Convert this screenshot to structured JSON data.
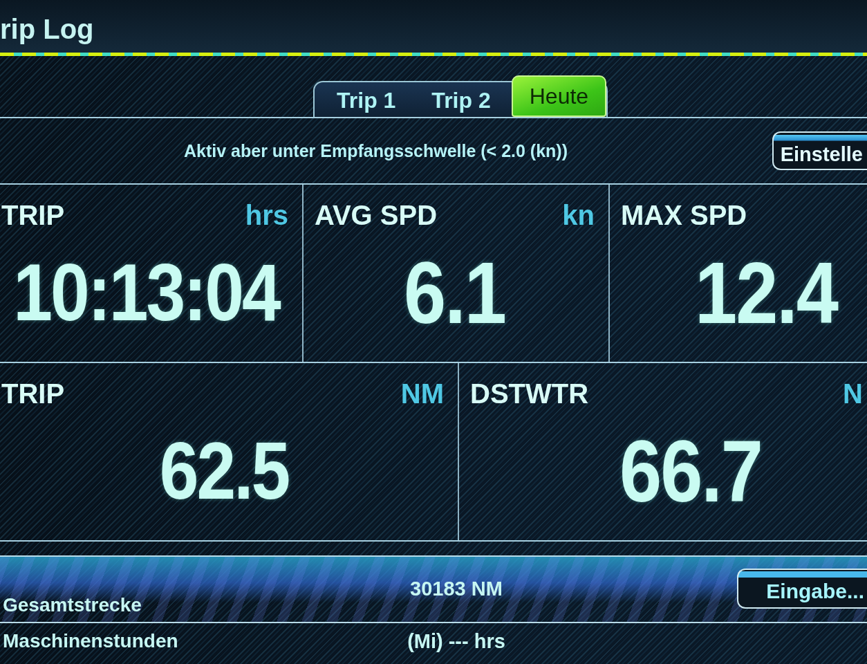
{
  "screen": {
    "title": "rip Log"
  },
  "tabs": [
    {
      "label": "Trip 1",
      "selected": false
    },
    {
      "label": "Trip 2",
      "selected": false
    },
    {
      "label": "Heute",
      "selected": true
    }
  ],
  "status_message": "Aktiv aber unter Empfangsschwelle (< 2.0 (kn))",
  "settings_button": "Einstelle",
  "tile_rows": [
    {
      "tiles": [
        {
          "label": "TRIP",
          "unit": "hrs",
          "value": "10:13:04"
        },
        {
          "label": "AVG SPD",
          "unit": "kn",
          "value": "6.1"
        },
        {
          "label": "MAX SPD",
          "value": "12.4"
        }
      ]
    },
    {
      "tiles": [
        {
          "label": "TRIP",
          "unit": "NM",
          "value": "62.5"
        },
        {
          "label": "DSTWTR",
          "unit": "N",
          "value": "66.7"
        }
      ]
    }
  ],
  "totals": [
    {
      "label": "Gesamtstrecke",
      "value": "30183 NM",
      "button": "Eingabe...",
      "selected": true
    },
    {
      "label": "Maschinenstunden",
      "value": "(Mi) --- hrs",
      "selected": false
    }
  ]
}
